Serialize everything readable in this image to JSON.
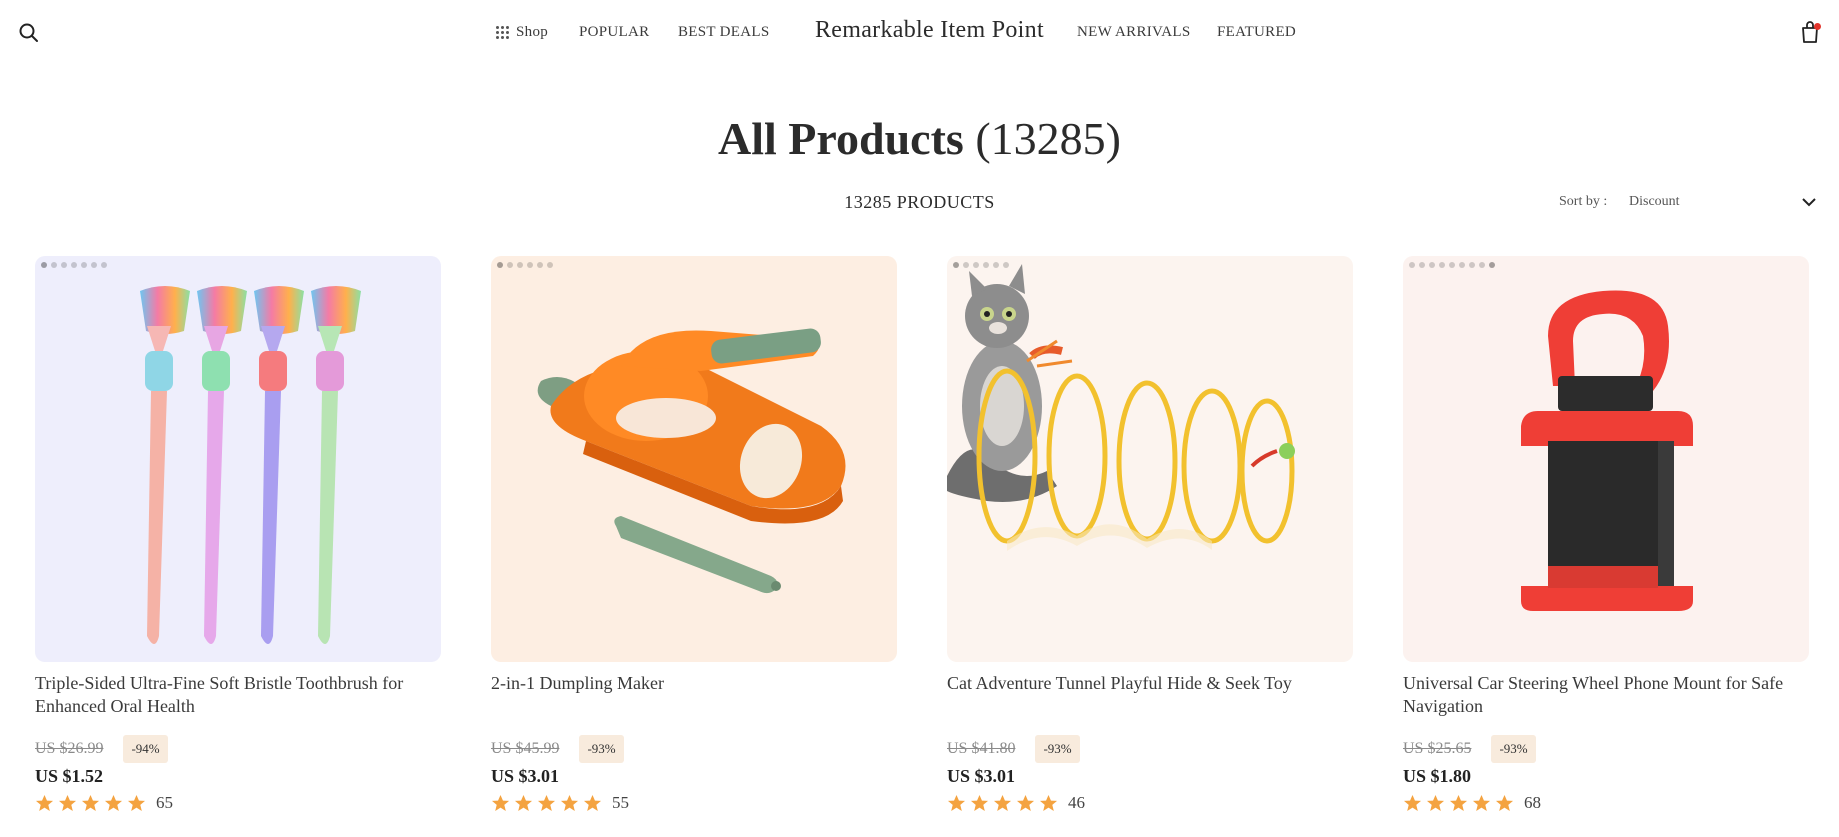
{
  "header": {
    "brand": "Remarkable Item Point",
    "nav": {
      "shop": "Shop",
      "popular": "POPULAR",
      "best_deals": "BEST DEALS",
      "new_arrivals": "NEW ARRIVALS",
      "featured": "FEATURED"
    },
    "icons": {
      "search": "search-icon",
      "cart": "shopping-bag-icon",
      "shop": "grid-icon"
    }
  },
  "page": {
    "title": "All Products",
    "title_count": "(13285)",
    "products_count": "13285 PRODUCTS",
    "sort_label": "Sort by :",
    "sort_value": "Discount"
  },
  "colors": {
    "star": "#f4a340",
    "discount_bg": "#f8ebdd",
    "cart_badge": "#e2332b"
  },
  "products": [
    {
      "title": "Triple-Sided Ultra-Fine Soft Bristle Toothbrush for Enhanced Oral Health",
      "old_price": "US $26.99",
      "discount": "-94%",
      "price": "US $1.52",
      "rating": 5,
      "reviews": "65",
      "image_bg": "#eeeefc"
    },
    {
      "title": "2-in-1 Dumpling Maker",
      "old_price": "US $45.99",
      "discount": "-93%",
      "price": "US $3.01",
      "rating": 5,
      "reviews": "55",
      "image_bg": "#fdeee2"
    },
    {
      "title": "Cat Adventure Tunnel Playful Hide & Seek Toy",
      "old_price": "US $41.80",
      "discount": "-93%",
      "price": "US $3.01",
      "rating": 5,
      "reviews": "46",
      "image_bg": "#fcf4ef"
    },
    {
      "title": "Universal Car Steering Wheel Phone Mount for Safe Navigation",
      "old_price": "US $25.65",
      "discount": "-93%",
      "price": "US $1.80",
      "rating": 5,
      "reviews": "68",
      "image_bg": "#fcf2ef"
    }
  ]
}
